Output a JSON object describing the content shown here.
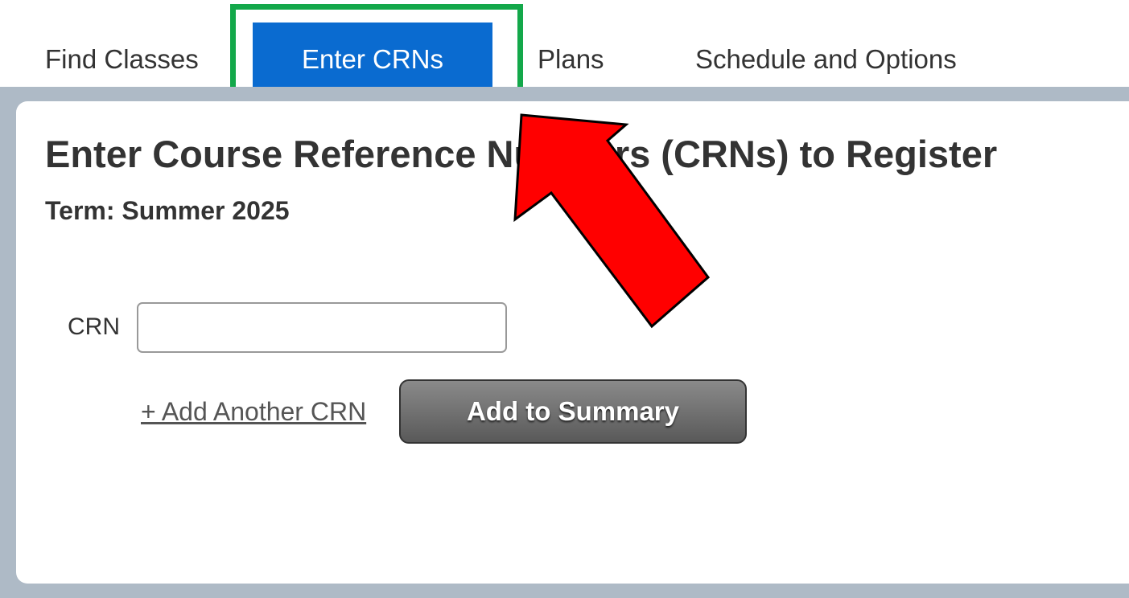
{
  "tabs": [
    {
      "label": "Find Classes"
    },
    {
      "label": "Enter CRNs",
      "active": true
    },
    {
      "label": "Plans"
    },
    {
      "label": "Schedule and Options"
    }
  ],
  "main": {
    "heading": "Enter Course Reference Numbers (CRNs) to Register",
    "term": "Term: Summer 2025",
    "crn_label": "CRN",
    "crn_value": "",
    "add_another_label": "+ Add Another CRN",
    "add_summary_label": "Add to Summary"
  },
  "colors": {
    "active_tab": "#0a6bd0",
    "highlight": "#13a84a",
    "arrow": "#ff0000",
    "frame": "#aebac6"
  }
}
